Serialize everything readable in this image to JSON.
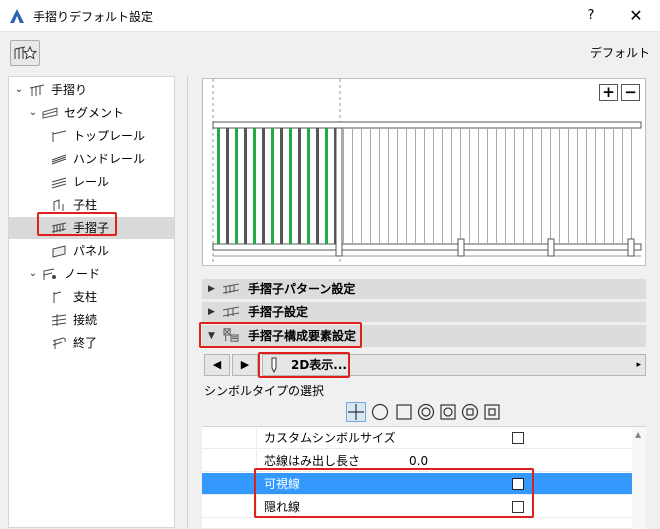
{
  "window": {
    "title": "手摺りデフォルト設定",
    "help_label": "?",
    "close_label": "✕",
    "default_label": "デフォルト"
  },
  "tree": {
    "items": [
      {
        "label": "手摺り",
        "icon": "railing-icon"
      },
      {
        "label": "セグメント",
        "icon": "segment-icon"
      },
      {
        "label": "トップレール",
        "icon": "top-rail-icon"
      },
      {
        "label": "ハンドレール",
        "icon": "handrail-icon"
      },
      {
        "label": "レール",
        "icon": "rail-icon"
      },
      {
        "label": "子柱",
        "icon": "inner-post-icon"
      },
      {
        "label": "手摺子",
        "icon": "baluster-icon"
      },
      {
        "label": "パネル",
        "icon": "panel-icon"
      },
      {
        "label": "ノード",
        "icon": "node-icon"
      },
      {
        "label": "支柱",
        "icon": "post-icon"
      },
      {
        "label": "接続",
        "icon": "connection-icon"
      },
      {
        "label": "終了",
        "icon": "end-icon"
      }
    ]
  },
  "preview": {
    "zoom_in_label": "+",
    "zoom_out_label": "−"
  },
  "sections": {
    "pattern": "手摺子パターン設定",
    "settings": "手摺子設定",
    "components": "手摺子構成要素設定"
  },
  "nav": {
    "prev_label": "◀",
    "next_label": "▶",
    "panel_label": "2D表示...",
    "expand_label": "▸"
  },
  "symbol": {
    "label": "シンボルタイプの選択"
  },
  "properties": {
    "rows": [
      {
        "label": "カスタムシンボルサイズ",
        "value": "",
        "checked": false
      },
      {
        "label": "芯線はみ出し長さ",
        "value": "0.0"
      },
      {
        "label": "可視線",
        "value": "",
        "checked": false
      },
      {
        "label": "隠れ線",
        "value": "",
        "checked": false
      }
    ]
  },
  "colors": {
    "accent": "#3399ff",
    "highlight": "#e0201b",
    "baluster_selected": "#22aa44"
  }
}
